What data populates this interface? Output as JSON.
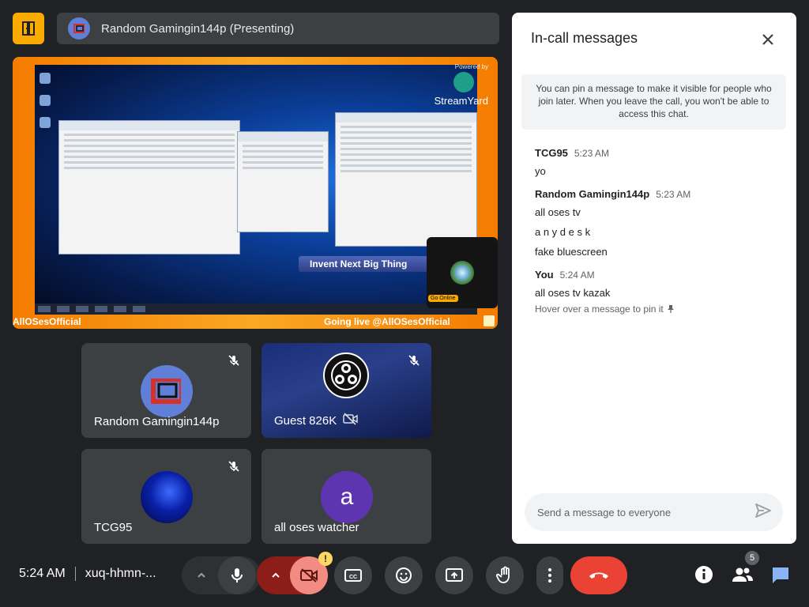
{
  "presenter": {
    "name": "Random Gamingin144p (Presenting)"
  },
  "presentation": {
    "powered_by": "Powered by",
    "brand": "StreamYard",
    "banner_title": "Invent Next Big Thing",
    "footer_left": "AllOSesOfficial",
    "footer_right": "Going live @AllOSesOfficial",
    "live_label": "Go Online"
  },
  "tiles": [
    {
      "name": "Random Gamingin144p",
      "avatar_color": "#5f7fd8"
    },
    {
      "name": "Guest 826K",
      "avatar_color": "#000000"
    },
    {
      "name": "TCG95",
      "avatar_color": "#0a1fa8"
    },
    {
      "name": "all oses watcher",
      "avatar_letter": "a",
      "avatar_color": "#5e35b1"
    }
  ],
  "bottom": {
    "time": "5:24 AM",
    "meeting_code": "xuq-hhmn-...",
    "warning_badge": "!",
    "people_count": "5"
  },
  "panel": {
    "title": "In-call messages",
    "notice": "You can pin a message to make it visible for people who join later. When you leave the call, you won't be able to access this chat.",
    "messages": [
      {
        "sender": "TCG95",
        "time": "5:23 AM",
        "lines": [
          "yo"
        ]
      },
      {
        "sender": "Random Gamingin144p",
        "time": "5:23 AM",
        "lines": [
          "all oses tv",
          "a n y d e s k",
          "fake bluescreen"
        ]
      },
      {
        "sender": "You",
        "time": "5:24 AM",
        "lines": [
          "all oses tv kazak"
        ]
      }
    ],
    "pin_hint": "Hover over a message to pin it",
    "composer_placeholder": "Send a message to everyone"
  },
  "colors": {
    "background": "#202124",
    "surface": "#3c4043",
    "accent_yellow": "#f9ab00",
    "end_call": "#ea4335",
    "chat_blue": "#8ab4f8"
  }
}
